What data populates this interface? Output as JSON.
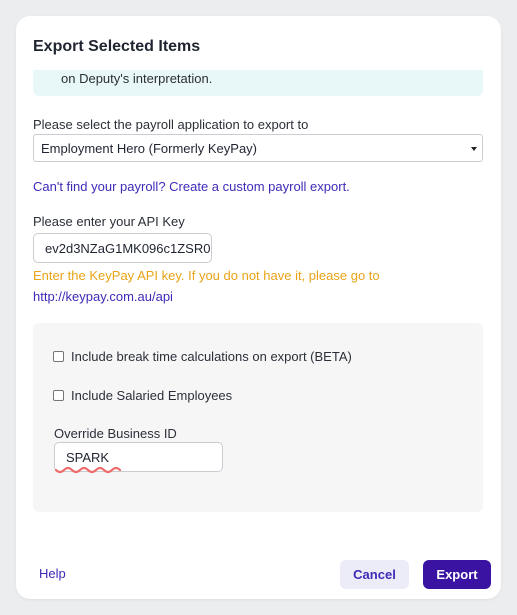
{
  "modal": {
    "title": "Export Selected Items",
    "info_text": "on Deputy's interpretation.",
    "payroll_label": "Please select the payroll application to export to",
    "payroll_selected": "Employment Hero (Formerly KeyPay)",
    "custom_link": "Can't find your payroll? Create a custom payroll export.",
    "api_key_label": "Please enter your API Key",
    "api_key_value": "ev2d3NZaG1MK096c1ZSR0",
    "api_key_hint": "Enter the KeyPay API key. If you do not have it, please go to",
    "api_key_link": "http://keypay.com.au/api",
    "options": {
      "break_time_label": "Include break time calculations on export (BETA)",
      "break_time_checked": false,
      "salaried_label": "Include Salaried Employees",
      "salaried_checked": false,
      "override_label": "Override Business ID",
      "override_value": "SPARK"
    },
    "footer": {
      "help_label": "Help",
      "cancel_label": "Cancel",
      "export_label": "Export"
    }
  },
  "colors": {
    "accent": "#3a13a3",
    "link": "#3d2bb8",
    "warning": "#e8a317",
    "info_bg": "#e8f8f8",
    "spellcheck": "#f06c6c"
  }
}
